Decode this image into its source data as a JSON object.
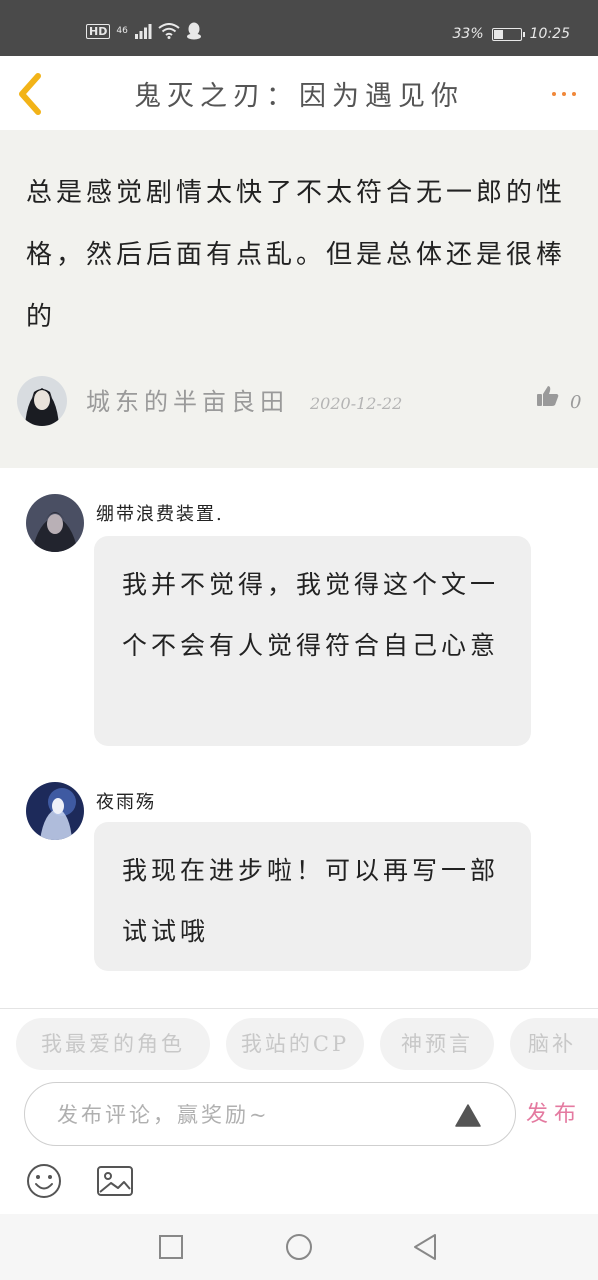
{
  "status_bar": {
    "hd": "HD",
    "network": "46",
    "battery_text": "33%",
    "battery_level": 0.33,
    "time": "10:25"
  },
  "header": {
    "title": "鬼灭之刃：因为遇见你"
  },
  "original_comment": {
    "text": "总是感觉剧情太快了不太符合无一郎的性格，然后后面有点乱。但是总体还是很棒的",
    "username": "城东的半亩良田",
    "date": "2020-12-22",
    "likes": "0"
  },
  "replies": [
    {
      "username": "绷带浪费装置.",
      "text": "我并不觉得，我觉得这个文一个不会有人觉得符合自己心意"
    },
    {
      "username": "夜雨殇",
      "text": "我现在进步啦！可以再写一部试试哦"
    }
  ],
  "tags": [
    "我最爱的角色",
    "我站的CP",
    "神预言",
    "脑补"
  ],
  "input": {
    "placeholder": "发布评论，赢奖励~",
    "value": ""
  },
  "publish_label": "发布",
  "colors": {
    "accent_back": "#f2b318",
    "more_dots": "#f0883a",
    "publish": "#e47aa0"
  },
  "icons": {
    "back": "chevron-left-icon",
    "more": "more-dots-icon",
    "like": "thumbs-up-icon",
    "send": "triangle-send-icon",
    "emoji": "smile-icon",
    "image": "image-icon"
  }
}
